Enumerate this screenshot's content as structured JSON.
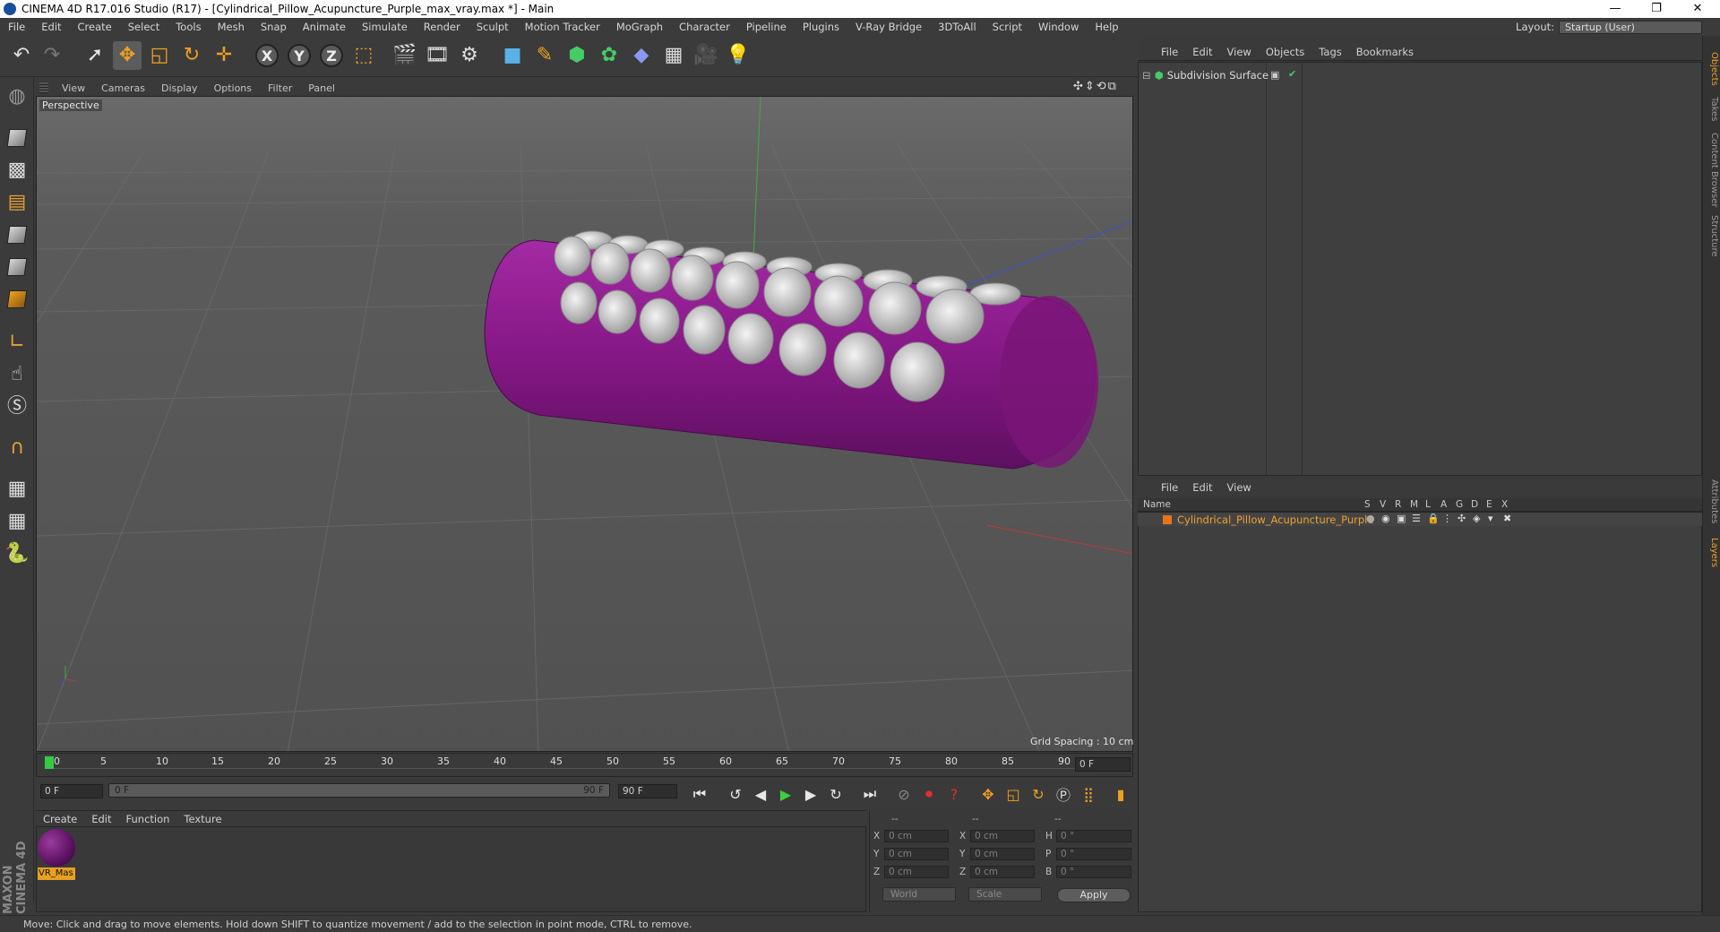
{
  "window": {
    "title": "CINEMA 4D R17.016 Studio (R17) - [Cylindrical_Pillow_Acupuncture_Purple_max_vray.max *] - Main",
    "minimize": "—",
    "maximize": "❐",
    "close": "✕"
  },
  "menubar": [
    "File",
    "Edit",
    "Create",
    "Select",
    "Tools",
    "Mesh",
    "Snap",
    "Animate",
    "Simulate",
    "Render",
    "Sculpt",
    "Motion Tracker",
    "MoGraph",
    "Character",
    "Pipeline",
    "Plugins",
    "V-Ray Bridge",
    "3DToAll",
    "Script",
    "Window",
    "Help"
  ],
  "layout": {
    "label": "Layout:",
    "value": "Startup (User)"
  },
  "viewport": {
    "menu": [
      "View",
      "Cameras",
      "Display",
      "Options",
      "Filter",
      "Panel"
    ],
    "camera_label": "Perspective",
    "grid_spacing": "Grid Spacing : 10 cm",
    "nav_icons": "✣⇕⟲⧉"
  },
  "timeline": {
    "ticks": [
      "0",
      "5",
      "10",
      "15",
      "20",
      "25",
      "30",
      "35",
      "40",
      "45",
      "50",
      "55",
      "60",
      "65",
      "70",
      "75",
      "80",
      "85",
      "90"
    ],
    "end_field": "0 F",
    "current_frame": "0 F",
    "range_start": "0 F",
    "range_end": "90 F",
    "max_frame": "90 F"
  },
  "material_manager": {
    "menu": [
      "Create",
      "Edit",
      "Function",
      "Texture"
    ],
    "materials": [
      {
        "name": "VR_Mas",
        "color": "#6a1a70"
      }
    ]
  },
  "coordinates": {
    "headers": [
      "--",
      "--",
      "--"
    ],
    "rows": [
      {
        "a_label": "X",
        "a_value": "0 cm",
        "b_label": "X",
        "b_value": "0 cm",
        "c_label": "H",
        "c_value": "0 °"
      },
      {
        "a_label": "Y",
        "a_value": "0 cm",
        "b_label": "Y",
        "b_value": "0 cm",
        "c_label": "P",
        "c_value": "0 °"
      },
      {
        "a_label": "Z",
        "a_value": "0 cm",
        "b_label": "Z",
        "b_value": "0 cm",
        "c_label": "B",
        "c_value": "0 °"
      }
    ],
    "space": "World",
    "mode": "Scale",
    "apply": "Apply"
  },
  "object_manager": {
    "menu": [
      "File",
      "Edit",
      "View",
      "Objects",
      "Tags",
      "Bookmarks"
    ],
    "objects": [
      {
        "name": "Subdivision Surface"
      }
    ]
  },
  "layer_manager": {
    "menu": [
      "File",
      "Edit",
      "View"
    ],
    "columns": [
      "Name",
      "S",
      "V",
      "R",
      "M",
      "L",
      "A",
      "G",
      "D",
      "E",
      "X"
    ],
    "layers": [
      {
        "name": "Cylindrical_Pillow_Acupuncture_Purple",
        "color": "#e8741a"
      }
    ]
  },
  "right_tabs": [
    "Objects",
    "Takes",
    "Content Browser",
    "Structure",
    "Attributes",
    "Layers"
  ],
  "status": "Move: Click and drag to move elements. Hold down SHIFT to quantize movement / add to the selection in point mode, CTRL to remove.",
  "brand": "MAXON CINEMA 4D",
  "colors": {
    "pillow": "#8a1a8a",
    "accent": "#e8a020",
    "layer_name": "#f0a030"
  }
}
